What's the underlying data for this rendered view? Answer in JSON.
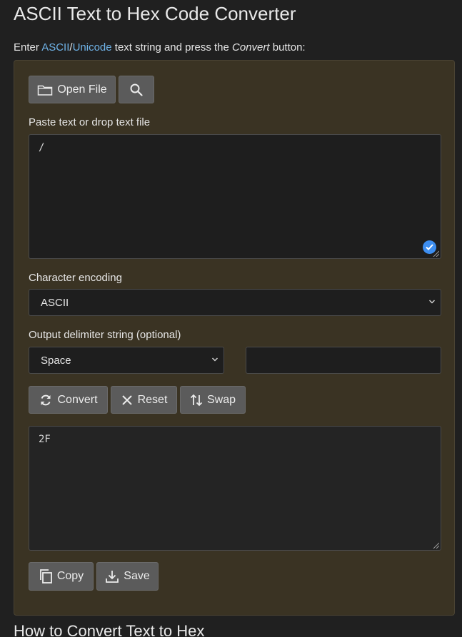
{
  "page": {
    "title": "ASCII Text to Hex Code Converter",
    "intro": {
      "prefix": "Enter ",
      "link_ascii": "ASCII",
      "slash": "/",
      "link_unicode": "Unicode",
      "middle": " text string and press the ",
      "convert_word": "Convert",
      "suffix": " button:"
    },
    "next_heading": "How to Convert Text to Hex"
  },
  "toolbar": {
    "open_file_label": "Open File",
    "open_file_icon": "folder-icon",
    "search_icon": "search-icon"
  },
  "input": {
    "label": "Paste text or drop text file",
    "value": "/"
  },
  "encoding": {
    "label": "Character encoding",
    "selected": "ASCII"
  },
  "delimiter": {
    "label": "Output delimiter string (optional)",
    "selected": "Space",
    "custom_value": ""
  },
  "actions": {
    "convert_label": "Convert",
    "reset_label": "Reset",
    "swap_label": "Swap"
  },
  "output": {
    "value": "2F"
  },
  "output_actions": {
    "copy_label": "Copy",
    "save_label": "Save"
  },
  "colors": {
    "panel_bg": "#3a3323",
    "page_bg": "#202020",
    "link": "#6fb3e8",
    "button_bg": "#5b5b5b",
    "badge": "#3d8ef0"
  }
}
